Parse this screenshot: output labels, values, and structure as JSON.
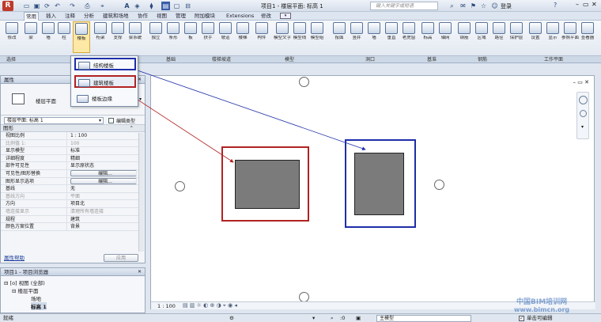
{
  "titlebar": {
    "title": "项目1 - 楼层平面: 标高 1",
    "search_placeholder": "键入关键字或短语",
    "user": "登录",
    "help": "?"
  },
  "menu": {
    "items": [
      "常用",
      "插入",
      "注释",
      "分析",
      "建筑和场地",
      "协作",
      "视图",
      "管理",
      "附加模块",
      "Extensions",
      "修改"
    ],
    "active_index": 0
  },
  "ribbon": {
    "buttons": [
      "修改",
      "梁",
      "墙",
      "柱",
      "楼板",
      "桁架",
      "支撑",
      "梁系统",
      "独立",
      "条形",
      "板",
      "扶手",
      "坡道",
      "楼梯",
      "构件",
      "模型文字",
      "模型线",
      "模型组",
      "按面",
      "竖井",
      "墙",
      "垂直",
      "老虎窗",
      "标高",
      "轴网",
      "钢筋",
      "区域",
      "路径",
      "保护层",
      "设置",
      "显示",
      "参照平面",
      "查看器"
    ],
    "groups": [
      "选择",
      "结构",
      "基础",
      "楼梯坡道",
      "模型",
      "洞口",
      "基准",
      "钢筋",
      "工作平面"
    ]
  },
  "dropdown": {
    "items": [
      "结构楼板",
      "建筑楼板",
      "楼板边缘"
    ],
    "highlight_color": "#b22222",
    "blue_color": "#1e2ea8"
  },
  "properties": {
    "title": "属性",
    "type_name": "楼层平面",
    "selector": "楼层平面: 标高 1",
    "edit_type": "编辑类型",
    "section": "图形",
    "rows": [
      {
        "k": "视图比例",
        "v": "1 : 100"
      },
      {
        "k": "比例值 1:",
        "v": "100"
      },
      {
        "k": "显示模型",
        "v": "标准"
      },
      {
        "k": "详细程度",
        "v": "精细"
      },
      {
        "k": "部件可见性",
        "v": "显示原状态"
      },
      {
        "k": "可见性/图形替换",
        "v": "编辑..."
      },
      {
        "k": "图形显示选项",
        "v": "编辑..."
      },
      {
        "k": "基线",
        "v": "无"
      },
      {
        "k": "基线方向",
        "v": "平面"
      },
      {
        "k": "方向",
        "v": "项目北"
      },
      {
        "k": "墙连接显示",
        "v": "清理所有墙连接"
      },
      {
        "k": "规程",
        "v": "建筑"
      },
      {
        "k": "颜色方案位置",
        "v": "背景"
      }
    ],
    "help": "属性帮助",
    "apply": "应用"
  },
  "browser": {
    "title": "项目1 - 项目浏览器",
    "items": [
      "视图 (全部)",
      "楼层平面",
      "场地",
      "标高 1"
    ]
  },
  "viewbar": {
    "scale": "1 : 100"
  },
  "statusbar": {
    "text": "就绪",
    "zero": ":0",
    "model": "主模型",
    "single_click": "单击可编辑"
  },
  "watermark": {
    "line1": "中国BIM培训网",
    "line2": "www.bimcn.org"
  }
}
